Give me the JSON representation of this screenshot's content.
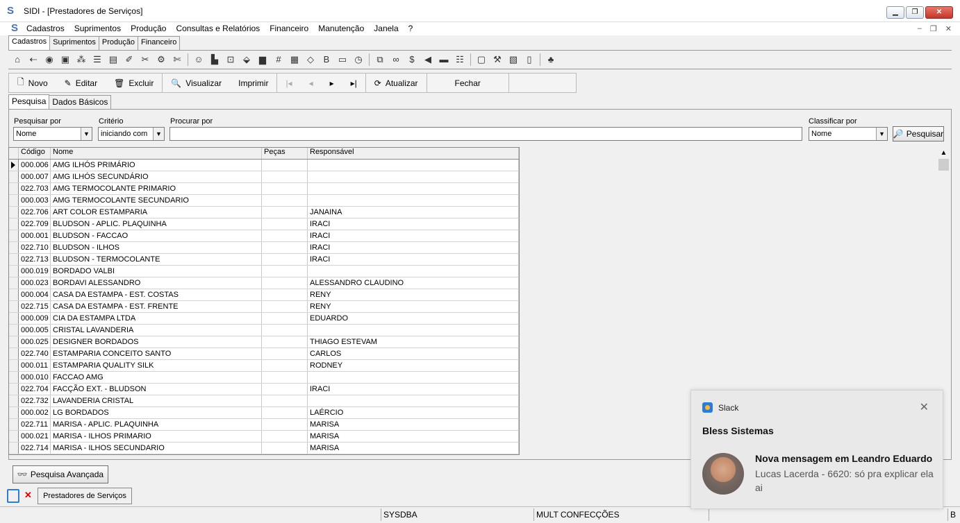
{
  "window": {
    "title": "SIDI - [Prestadores de Serviços]"
  },
  "menu": {
    "items": [
      "Cadastros",
      "Suprimentos",
      "Produção",
      "Consultas e Relatórios",
      "Financeiro",
      "Manutenção",
      "Janela",
      "?"
    ]
  },
  "module_tabs": [
    "Cadastros",
    "Suprimentos",
    "Produção",
    "Financeiro"
  ],
  "toolbar_icons": [
    "home-icon",
    "arrow-icon",
    "search-icon",
    "image-icon",
    "network-icon",
    "list-icon",
    "form-icon",
    "paint-icon",
    "tool-icon",
    "gear-icon",
    "scissors-icon",
    "smile-icon",
    "chart-icon",
    "frame-icon",
    "paint-bucket-icon",
    "book-icon",
    "grid-icon",
    "calculator-icon",
    "tag-icon",
    "bold-icon",
    "folder-icon",
    "clock-icon",
    "copy-icon",
    "link-icon",
    "dollar-icon",
    "arrow-left-icon",
    "cfop-icon",
    "settings-icon",
    "monitor-icon",
    "tools-icon",
    "report-icon",
    "doc-icon",
    "users-icon"
  ],
  "commands": {
    "novo": "Novo",
    "editar": "Editar",
    "excluir": "Excluir",
    "visualizar": "Visualizar",
    "imprimir": "Imprimir",
    "atualizar": "Atualizar",
    "fechar": "Fechar"
  },
  "content_tabs": [
    "Pesquisa",
    "Dados Básicos"
  ],
  "search": {
    "pesquisar_por_label": "Pesquisar por",
    "pesquisar_por_value": "Nome",
    "criterio_label": "Critério",
    "criterio_value": "iniciando com",
    "procurar_label": "Procurar por",
    "procurar_value": "",
    "classificar_label": "Classificar por",
    "classificar_value": "Nome",
    "button": "Pesquisar"
  },
  "grid": {
    "columns": [
      "Código",
      "Nome",
      "Peças",
      "Responsável"
    ],
    "rows": [
      [
        "000.006",
        "AMG ILHÓS PRIMÁRIO",
        "",
        ""
      ],
      [
        "000.007",
        "AMG ILHÓS SECUNDÁRIO",
        "",
        ""
      ],
      [
        "022.703",
        "AMG TERMOCOLANTE PRIMARIO",
        "",
        ""
      ],
      [
        "000.003",
        "AMG TERMOCOLANTE SECUNDARIO",
        "",
        ""
      ],
      [
        "022.706",
        "ART COLOR ESTAMPARIA",
        "",
        "JANAINA"
      ],
      [
        "022.709",
        "BLUDSON - APLIC. PLAQUINHA",
        "",
        "IRACI"
      ],
      [
        "000.001",
        "BLUDSON - FACCAO",
        "",
        "IRACI"
      ],
      [
        "022.710",
        "BLUDSON - ILHOS",
        "",
        "IRACI"
      ],
      [
        "022.713",
        "BLUDSON - TERMOCOLANTE",
        "",
        "IRACI"
      ],
      [
        "000.019",
        "BORDADO VALBI",
        "",
        ""
      ],
      [
        "000.023",
        "BORDAVI ALESSANDRO",
        "",
        "ALESSANDRO CLAUDINO"
      ],
      [
        "000.004",
        "CASA DA ESTAMPA - EST. COSTAS",
        "",
        "RENY"
      ],
      [
        "022.715",
        "CASA DA ESTAMPA - EST. FRENTE",
        "",
        "RENY"
      ],
      [
        "000.009",
        "CIA DA ESTAMPA LTDA",
        "",
        "EDUARDO"
      ],
      [
        "000.005",
        "CRISTAL LAVANDERIA",
        "",
        ""
      ],
      [
        "000.025",
        "DESIGNER BORDADOS",
        "",
        "THIAGO ESTEVAM"
      ],
      [
        "022.740",
        "ESTAMPARIA CONCEITO SANTO",
        "",
        "CARLOS"
      ],
      [
        "000.011",
        "ESTAMPARIA QUALITY SILK",
        "",
        "RODNEY"
      ],
      [
        "000.010",
        "FACCAO AMG",
        "",
        ""
      ],
      [
        "022.704",
        "FACÇÃO EXT. - BLUDSON",
        "",
        "IRACI"
      ],
      [
        "022.732",
        "LAVANDERIA CRISTAL",
        "",
        ""
      ],
      [
        "000.002",
        "LG BORDADOS",
        "",
        "LAÉRCIO"
      ],
      [
        "022.711",
        "MARISA - APLIC. PLAQUINHA",
        "",
        "MARISA"
      ],
      [
        "000.021",
        "MARISA - ILHOS PRIMARIO",
        "",
        "MARISA"
      ],
      [
        "022.714",
        "MARISA - ILHOS SECUNDARIO",
        "",
        "MARISA"
      ]
    ]
  },
  "advanced_button": "Pesquisa Avançada",
  "window_tab": "Prestadores de Serviços",
  "status": {
    "user": "SYSDBA",
    "company": "MULT CONFECÇÕES",
    "right": "B"
  },
  "toast": {
    "app": "Slack",
    "header": "Bless Sistemas",
    "title": "Nova mensagem em Leandro Eduardo",
    "body": "Lucas Lacerda - 6620: só pra explicar ela ai"
  }
}
